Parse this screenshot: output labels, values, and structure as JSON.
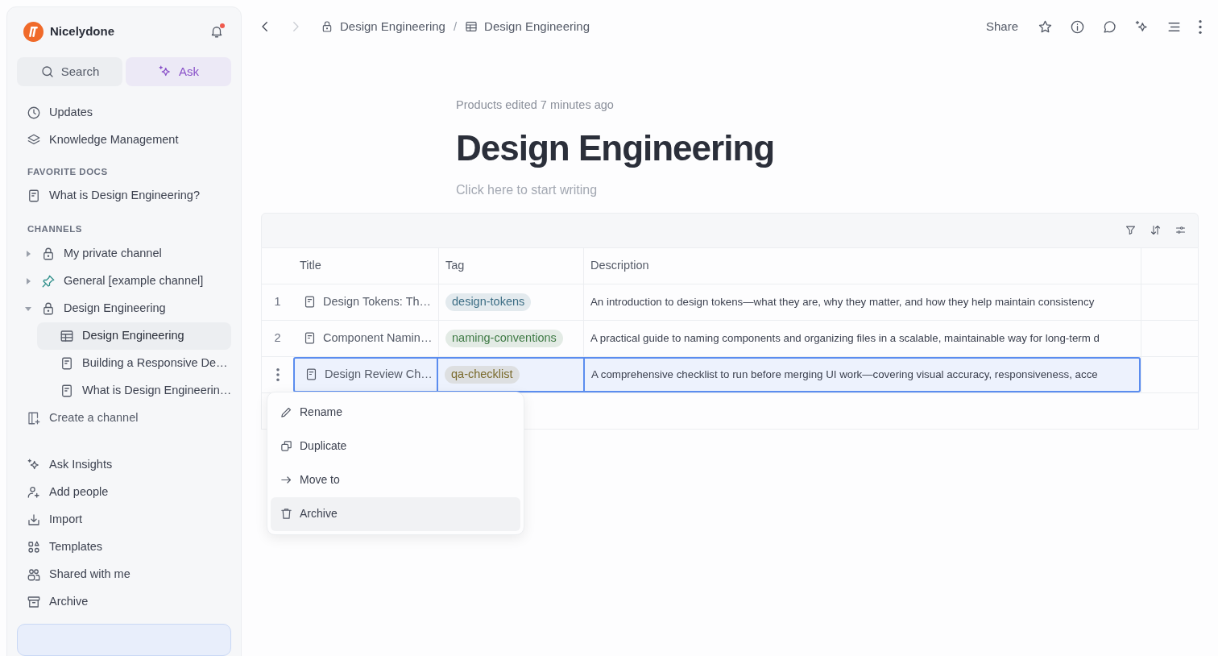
{
  "sidebar": {
    "workspace": "Nicelydone",
    "unread": true,
    "search_button": "Search",
    "ask_button": "Ask",
    "nav": [
      {
        "label": "Updates"
      },
      {
        "label": "Knowledge Management"
      }
    ],
    "favorites": {
      "heading": "FAVORITE DOCS",
      "items": [
        {
          "label": "What is Design Engineering?"
        }
      ]
    },
    "channels": {
      "heading": "CHANNELS",
      "items": [
        {
          "label": "My private channel",
          "kind": "private",
          "expanded": false
        },
        {
          "label": "General [example channel]",
          "kind": "pinned",
          "expanded": false
        },
        {
          "label": "Design Engineering",
          "kind": "private",
          "expanded": true,
          "children": [
            {
              "label": "Design Engineering",
              "kind": "table",
              "selected": true
            },
            {
              "label": "Building a Responsive De…",
              "kind": "doc",
              "selected": false
            },
            {
              "label": "What is Design Engineerin…",
              "kind": "doc",
              "selected": false
            }
          ]
        }
      ],
      "create": "Create a channel"
    },
    "footer_items": [
      {
        "label": "Ask Insights"
      },
      {
        "label": "Add people"
      },
      {
        "label": "Import"
      },
      {
        "label": "Templates"
      },
      {
        "label": "Shared with me"
      },
      {
        "label": "Archive"
      }
    ]
  },
  "topbar": {
    "forward_enabled": false,
    "breadcrumbs": [
      {
        "label": "Design Engineering",
        "kind": "channel"
      },
      {
        "label": "Design Engineering",
        "kind": "table"
      }
    ],
    "separator": "/",
    "share": "Share"
  },
  "page": {
    "meta": "Products edited 7 minutes ago",
    "title": "Design Engineering",
    "placeholder": "Click here to start writing"
  },
  "table": {
    "columns": [
      "Title",
      "Tag",
      "Description"
    ],
    "rows": [
      {
        "number": "1",
        "title": "Design Tokens: Th…",
        "tag": {
          "label": "design-tokens",
          "color": "#3d6e85"
        },
        "description": "An introduction to design tokens—what they are, why they matter, and how they help maintain consistency",
        "selected": false
      },
      {
        "number": "2",
        "title": "Component Namin…",
        "tag": {
          "label": "naming-conventions",
          "color": "#3f7a45"
        },
        "description": "A practical guide to naming components and organizing files in a scalable, maintainable way for long-term d",
        "selected": false
      },
      {
        "title": "Design Review Ch…",
        "tag": {
          "label": "qa-checklist",
          "color": "#7a6a2c"
        },
        "description": "A comprehensive checklist to run before merging UI work—covering visual accuracy, responsiveness, acce",
        "selected": true
      }
    ],
    "menu": {
      "items": [
        {
          "label": "Rename",
          "selected": false
        },
        {
          "label": "Duplicate",
          "selected": false
        },
        {
          "label": "Move to",
          "selected": false
        },
        {
          "label": "Archive",
          "selected": true
        }
      ]
    }
  }
}
